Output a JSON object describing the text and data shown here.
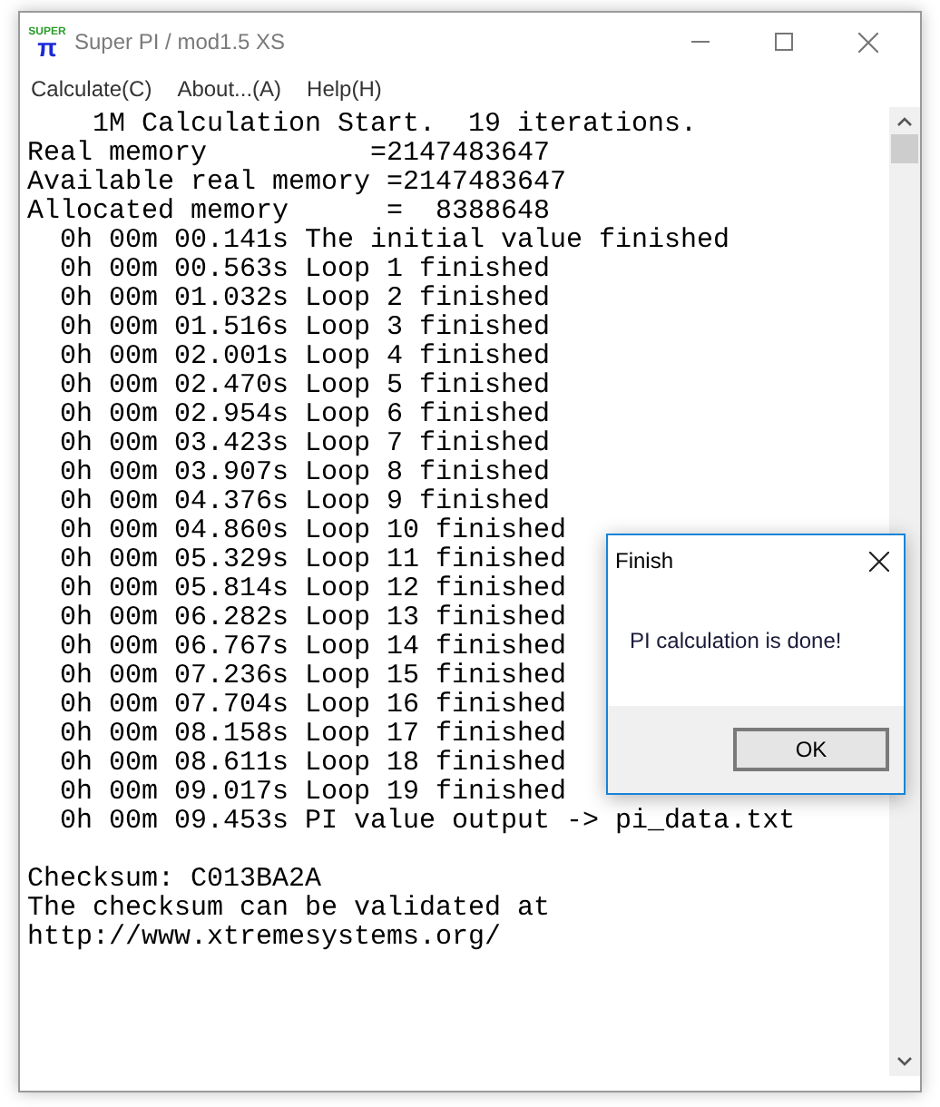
{
  "window": {
    "title": "Super PI / mod1.5 XS",
    "logo_top": "SUPER",
    "logo_bottom": "π"
  },
  "menu": [
    "Calculate(C)",
    "About...(A)",
    "Help(H)"
  ],
  "log_lines": [
    "    1M Calculation Start.  19 iterations.",
    "Real memory          =2147483647",
    "Available real memory =2147483647",
    "Allocated memory      =  8388648",
    "  0h 00m 00.141s The initial value finished",
    "  0h 00m 00.563s Loop 1 finished",
    "  0h 00m 01.032s Loop 2 finished",
    "  0h 00m 01.516s Loop 3 finished",
    "  0h 00m 02.001s Loop 4 finished",
    "  0h 00m 02.470s Loop 5 finished",
    "  0h 00m 02.954s Loop 6 finished",
    "  0h 00m 03.423s Loop 7 finished",
    "  0h 00m 03.907s Loop 8 finished",
    "  0h 00m 04.376s Loop 9 finished",
    "  0h 00m 04.860s Loop 10 finished",
    "  0h 00m 05.329s Loop 11 finished",
    "  0h 00m 05.814s Loop 12 finished",
    "  0h 00m 06.282s Loop 13 finished",
    "  0h 00m 06.767s Loop 14 finished",
    "  0h 00m 07.236s Loop 15 finished",
    "  0h 00m 07.704s Loop 16 finished",
    "  0h 00m 08.158s Loop 17 finished",
    "  0h 00m 08.611s Loop 18 finished",
    "  0h 00m 09.017s Loop 19 finished",
    "  0h 00m 09.453s PI value output -> pi_data.txt"
  ],
  "result_lines": [
    "Checksum: C013BA2A",
    "The checksum can be validated at",
    "http://www.xtremesystems.org/"
  ],
  "dialog": {
    "title": "Finish",
    "message": "PI calculation is done!",
    "button": "OK"
  }
}
